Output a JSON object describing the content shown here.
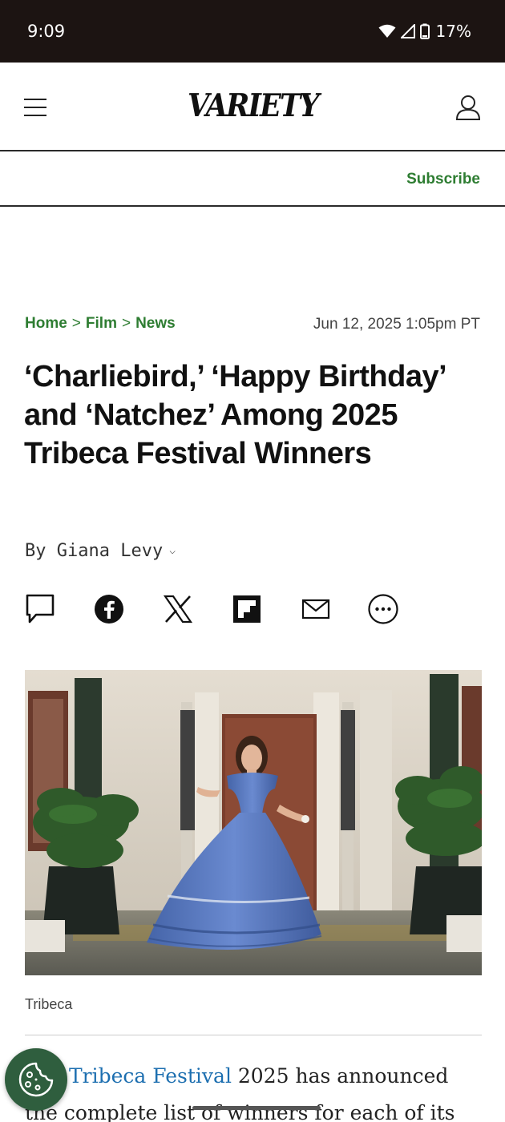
{
  "status_bar": {
    "time": "9:09",
    "battery": "17%"
  },
  "header": {
    "logo": "VARIETY"
  },
  "subscribe": {
    "label": "Subscribe"
  },
  "breadcrumb": {
    "items": [
      "Home",
      "Film",
      "News"
    ],
    "separator": ">"
  },
  "article": {
    "timestamp": "Jun 12, 2025 1:05pm PT",
    "headline": "‘Charliebird,’ ‘Happy Birthday’ and ‘Natchez’ Among 2025 Tribeca Festival Winners",
    "byline": "By Giana Levy",
    "image_caption": "Tribeca",
    "body_link": "Tribeca Festival",
    "body_line1_rest": " 2025 has announced",
    "body_line2": "the complete list of winners for each of its"
  },
  "share": {
    "icons": [
      "comment-icon",
      "facebook-icon",
      "x-icon",
      "flipboard-icon",
      "email-icon",
      "more-icon"
    ]
  },
  "colors": {
    "status_bar": "#1c1412",
    "accent_green": "#2e7d32",
    "link_blue": "#1d6fb0",
    "cookie_button": "#2f5e3e"
  }
}
